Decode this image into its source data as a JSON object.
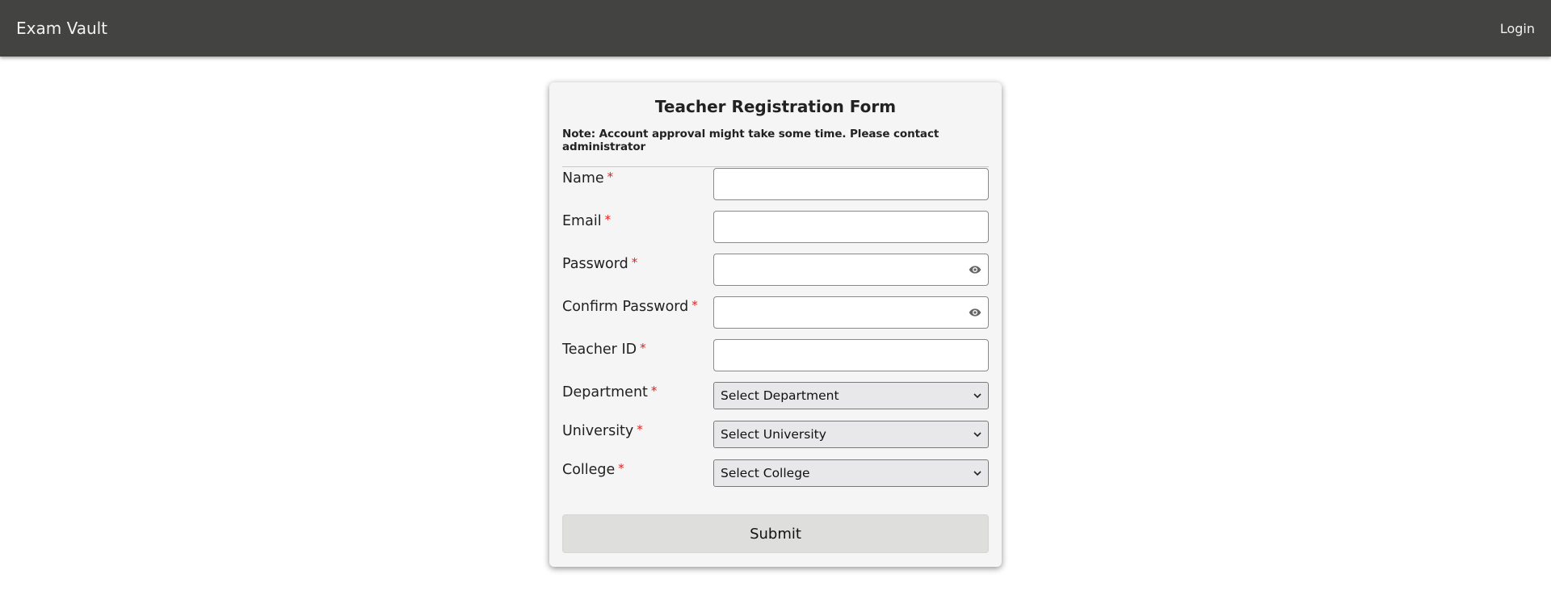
{
  "navbar": {
    "brand": "Exam Vault",
    "login": "Login"
  },
  "form": {
    "title": "Teacher Registration Form",
    "note": "Note: Account approval might take some time. Please contact administrator",
    "required_mark": "*",
    "fields": {
      "name": {
        "label": "Name",
        "value": ""
      },
      "email": {
        "label": "Email",
        "value": ""
      },
      "password": {
        "label": "Password",
        "value": "",
        "icon": "eye-icon"
      },
      "confirm_password": {
        "label": "Confirm Password",
        "value": "",
        "icon": "eye-icon"
      },
      "teacher_id": {
        "label": "Teacher ID",
        "value": ""
      },
      "department": {
        "label": "Department",
        "selected": "Select Department"
      },
      "university": {
        "label": "University",
        "selected": "Select University"
      },
      "college": {
        "label": "College",
        "selected": "Select College"
      }
    },
    "submit_label": "Submit"
  },
  "colors": {
    "navbar_bg": "#434341",
    "card_bg": "#f5f5f5",
    "required": "#e02020",
    "select_bg": "#e8e8ea",
    "submit_bg": "#dededc"
  }
}
